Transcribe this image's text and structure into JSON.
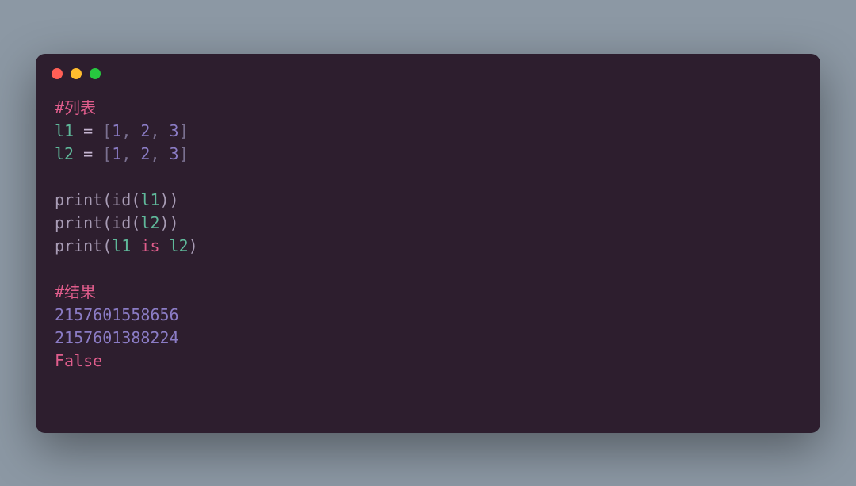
{
  "code": {
    "comment1": "#列表",
    "line2": {
      "var": "l1",
      "eq": " = ",
      "lb": "[",
      "n1": "1",
      "c1": ", ",
      "n2": "2",
      "c2": ", ",
      "n3": "3",
      "rb": "]"
    },
    "line3": {
      "var": "l2",
      "eq": " = ",
      "lb": "[",
      "n1": "1",
      "c1": ", ",
      "n2": "2",
      "c2": ", ",
      "n3": "3",
      "rb": "]"
    },
    "line5": {
      "fn1": "print",
      "p1": "(",
      "fn2": "id",
      "p2": "(",
      "var": "l1",
      "p3": ")",
      "p4": ")"
    },
    "line6": {
      "fn1": "print",
      "p1": "(",
      "fn2": "id",
      "p2": "(",
      "var": "l2",
      "p3": ")",
      "p4": ")"
    },
    "line7": {
      "fn1": "print",
      "p1": "(",
      "var1": "l1",
      "sp1": " ",
      "kw": "is",
      "sp2": " ",
      "var2": "l2",
      "p2": ")"
    },
    "comment2": "#结果",
    "out1": "2157601558656",
    "out2": "2157601388224",
    "out3": "False"
  }
}
